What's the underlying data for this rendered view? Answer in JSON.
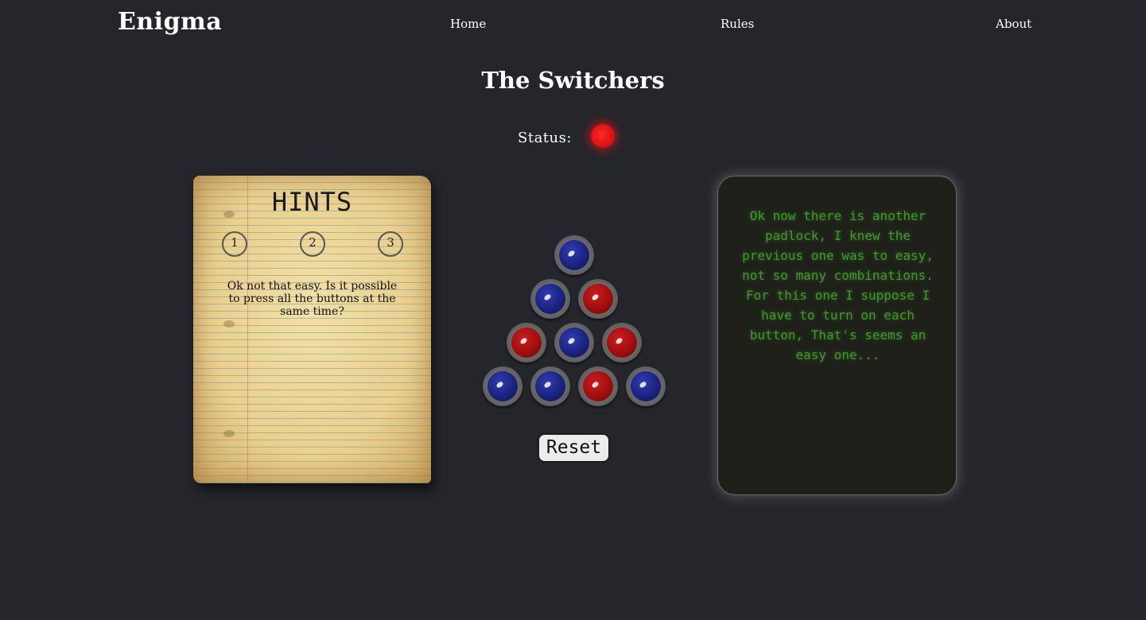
{
  "nav": {
    "brand": "Enigma",
    "links": [
      {
        "label": "Home"
      },
      {
        "label": "Rules"
      },
      {
        "label": "About"
      }
    ]
  },
  "page": {
    "title": "The Switchers"
  },
  "status": {
    "label": "Status:",
    "state": "red",
    "color": "#e01313"
  },
  "hints": {
    "title": "HINTS",
    "buttons": [
      "1",
      "2",
      "3"
    ],
    "text": "Ok not that easy. Is it possible to press all the buttons at the same time?"
  },
  "puzzle": {
    "rows": [
      [
        "blue"
      ],
      [
        "blue",
        "red"
      ],
      [
        "red",
        "blue",
        "red"
      ],
      [
        "blue",
        "blue",
        "red",
        "blue"
      ]
    ],
    "colors": {
      "blue": "#1a237f",
      "red": "#a10e0e"
    },
    "reset_label": "Reset"
  },
  "terminal": {
    "text": "Ok now there is another padlock, I knew the previous one was to easy, not so many combinations. For this one I suppose I have to turn on each button, That's seems an easy one...",
    "color": "#3f9a2e"
  }
}
